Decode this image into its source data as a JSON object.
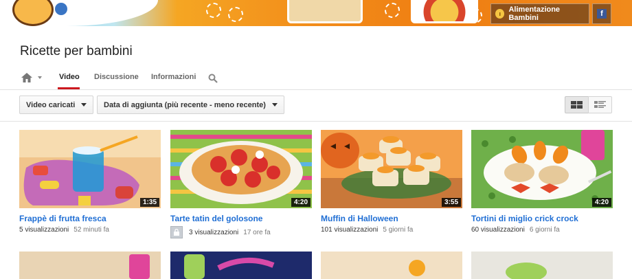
{
  "banner": {
    "channel_badge_label": "Alimentazione Bambini",
    "facebook_label": "f"
  },
  "channel": {
    "title": "Ricette per bambini"
  },
  "tabs": [
    {
      "label": "Video",
      "active": true
    },
    {
      "label": "Discussione",
      "active": false
    },
    {
      "label": "Informazioni",
      "active": false
    }
  ],
  "toolbar": {
    "uploads_dropdown": "Video caricati",
    "sort_dropdown": "Data di aggiunta (più recente - meno recente)"
  },
  "videos": [
    {
      "title": "Frappè di frutta fresca",
      "views": "5 visualizzazioni",
      "age": "52 minuti fa",
      "duration": "1:35"
    },
    {
      "title": "Tarte tatin del golosone",
      "views": "3 visualizzazioni",
      "age": "17 ore fa",
      "duration": "4:20"
    },
    {
      "title": "Muffin di Halloween",
      "views": "101 visualizzazioni",
      "age": "5 giorni fa",
      "duration": "3:55"
    },
    {
      "title": "Tortini di miglio crick crock",
      "views": "60 visualizzazioni",
      "age": "6 giorni fa",
      "duration": "4:20"
    }
  ],
  "colors": {
    "accent_red": "#cc181e",
    "link_blue": "#1f6ed4",
    "banner_orange": "#f08a1c"
  }
}
